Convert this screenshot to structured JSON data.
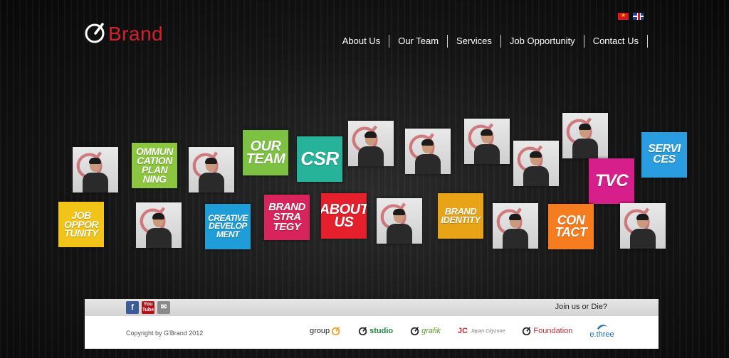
{
  "brand": {
    "name": "Brand",
    "accent": "#d3202d"
  },
  "languages": [
    {
      "code": "vi",
      "icon": "vietnam-flag-icon"
    },
    {
      "code": "en",
      "icon": "uk-flag-icon"
    }
  ],
  "nav": {
    "items": [
      "About Us",
      "Our Team",
      "Services",
      "Job Opportunity",
      "Contact Us"
    ]
  },
  "tiles": [
    {
      "kind": "photo",
      "name": "team-member-1"
    },
    {
      "kind": "word",
      "text": "OMMUN\nCATION\nPLAN\nNING",
      "color": "#8cc63f"
    },
    {
      "kind": "photo",
      "name": "team-member-2"
    },
    {
      "kind": "word",
      "text": "OUR\nTEAM",
      "color": "#7dc142"
    },
    {
      "kind": "word",
      "text": "CSR",
      "color": "#26b39a"
    },
    {
      "kind": "photo",
      "name": "team-member-3"
    },
    {
      "kind": "photo",
      "name": "team-member-4"
    },
    {
      "kind": "photo",
      "name": "team-member-5"
    },
    {
      "kind": "photo",
      "name": "team-member-6"
    },
    {
      "kind": "photo",
      "name": "team-member-7"
    },
    {
      "kind": "word",
      "text": "SERVI\nCES",
      "color": "#2a9de0"
    },
    {
      "kind": "word",
      "text": "TVC",
      "color": "#d61f8a"
    },
    {
      "kind": "word",
      "text": "JOB\nOPPOR\nTUNITY",
      "color": "#f2c417"
    },
    {
      "kind": "photo",
      "name": "team-member-8"
    },
    {
      "kind": "word",
      "text": "CREATIVE\nDEVELOP\nMENT",
      "color": "#1e9dd8"
    },
    {
      "kind": "word",
      "text": "BRAND\nSTRA\nTEGY",
      "color": "#d8245c"
    },
    {
      "kind": "word",
      "text": "ABOUT\nUS",
      "color": "#e61f2c"
    },
    {
      "kind": "photo",
      "name": "team-member-9"
    },
    {
      "kind": "word",
      "text": "BRAND\nIDENTITY",
      "color": "#e8a317"
    },
    {
      "kind": "photo",
      "name": "team-member-10"
    },
    {
      "kind": "word",
      "text": "CON\nTACT",
      "color": "#f57c1f"
    },
    {
      "kind": "photo",
      "name": "team-member-11"
    }
  ],
  "footer": {
    "social": [
      {
        "name": "facebook",
        "glyph": "f"
      },
      {
        "name": "youtube",
        "glyph": "You\nTube"
      },
      {
        "name": "email",
        "glyph": "✉"
      }
    ],
    "join": "Join us or Die?",
    "copyright": "Copyright by G'Brand 2012",
    "partners": {
      "group": "group",
      "studio": "studio",
      "grafik": "grafik",
      "jc": "JC",
      "jc_sub": "Japan Cityzone",
      "foundation": "Foundation",
      "ethree": "e.three"
    }
  }
}
